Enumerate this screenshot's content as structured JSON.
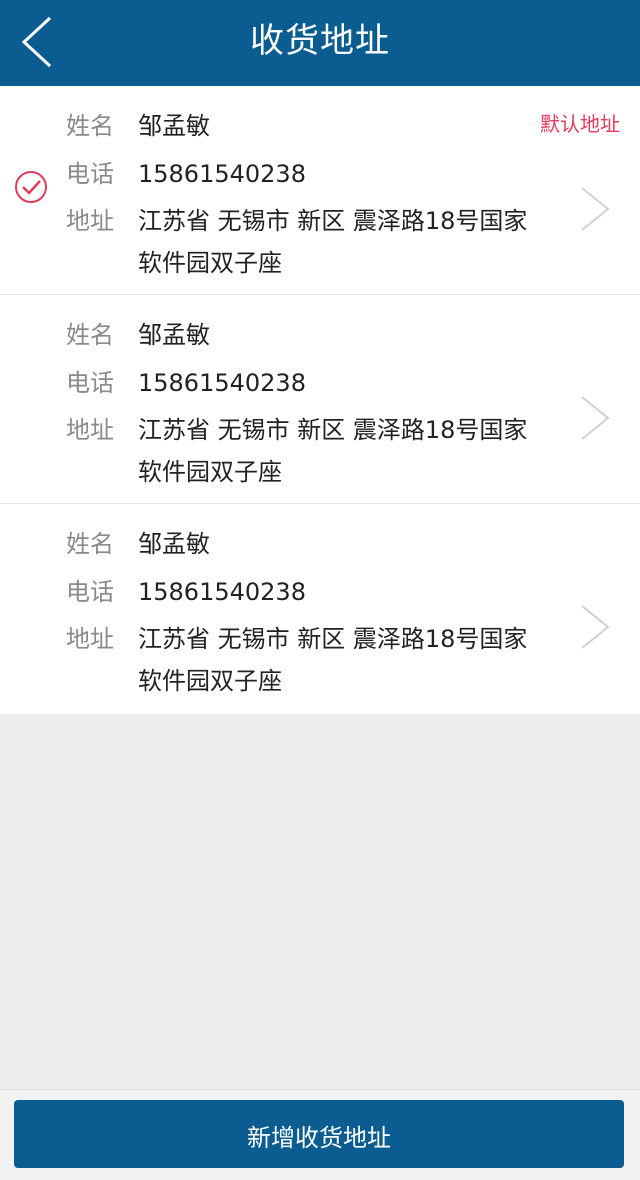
{
  "header": {
    "title": "收货地址",
    "back_icon": "chevron-left-icon"
  },
  "labels": {
    "name": "姓名",
    "phone": "电话",
    "address": "地址"
  },
  "addresses": [
    {
      "name": "邹孟敏",
      "phone": "15861540238",
      "address_line1": "江苏省 无锡市 新区 震泽路18号国家",
      "address_line2": "软件园双子座",
      "selected": true,
      "default_label": "默认地址"
    },
    {
      "name": "邹孟敏",
      "phone": "15861540238",
      "address_line1": "江苏省 无锡市 新区 震泽路18号国家",
      "address_line2": "软件园双子座",
      "selected": false
    },
    {
      "name": "邹孟敏",
      "phone": "15861540238",
      "address_line1": "江苏省 无锡市 新区 震泽路18号国家",
      "address_line2": "软件园双子座",
      "selected": false
    }
  ],
  "footer": {
    "add_button_label": "新增收货地址"
  },
  "colors": {
    "primary": "#0b5c90",
    "accent_red": "#e63a5a",
    "background": "#eeeeee"
  }
}
